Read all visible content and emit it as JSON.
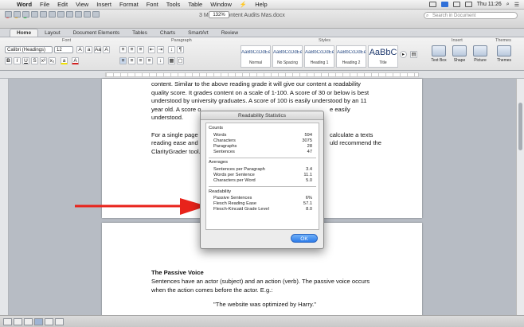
{
  "menubar": {
    "app": "Word",
    "items": [
      "File",
      "Edit",
      "View",
      "Insert",
      "Format",
      "Font",
      "Tools",
      "Table",
      "Window",
      "Help"
    ],
    "clock": "Thu 11:26"
  },
  "window": {
    "title": "3 Metrics Content Audits Mas.docx",
    "zoom": "132%",
    "search_placeholder": "Search in Document"
  },
  "ribbon": {
    "tabs": [
      "Home",
      "Layout",
      "Document Elements",
      "Tables",
      "Charts",
      "SmartArt",
      "Review"
    ],
    "groups": {
      "font": "Font",
      "paragraph": "Paragraph",
      "styles": "Styles",
      "insert": "Insert",
      "themes": "Themes"
    },
    "font_name": "Calibri (Headings)",
    "font_size": "12",
    "styles": [
      {
        "sample": "AaBbCcDdEe",
        "name": "Normal"
      },
      {
        "sample": "AaBbCcDdEe",
        "name": "No Spacing"
      },
      {
        "sample": "AaBbCcDdEe",
        "name": "Heading 1"
      },
      {
        "sample": "AaBbCcDdEe",
        "name": "Heading 2"
      },
      {
        "sample": "AaBbC",
        "name": "Title"
      }
    ],
    "insert_buttons": [
      "Text Box",
      "Shape",
      "Picture",
      "Themes"
    ]
  },
  "document": {
    "page1_lines": [
      "content. Similar to the above reading grade it will give our content a readability",
      "quality score. It grades content on a scale of 1-100. A score of 30 or below is best",
      "understood by university graduates. A score of 100 is easily understood by an 11",
      "year old. A score o",
      "understood.",
      "",
      "For a single page o",
      "reading ease and r",
      "ClarityGrader tool."
    ],
    "page1_right_fragments": [
      "e easily",
      "calculate a texts",
      "uld recommend the"
    ],
    "page2_heading": "The Passive Voice",
    "page2_lines": [
      "Sentences have an actor (subject) and an action (verb). The passive voice occurs",
      "when the action comes before the actor. E.g.:"
    ],
    "page2_quote": "\"The website was optimized by Harry.\""
  },
  "dialog": {
    "title": "Readability Statistics",
    "counts_title": "Counts",
    "counts": [
      {
        "label": "Words",
        "value": "594"
      },
      {
        "label": "Characters",
        "value": "3075"
      },
      {
        "label": "Paragraphs",
        "value": "28"
      },
      {
        "label": "Sentences",
        "value": "47"
      }
    ],
    "averages_title": "Averages",
    "averages": [
      {
        "label": "Sentences per Paragraph",
        "value": "3.4"
      },
      {
        "label": "Words per Sentence",
        "value": "11.1"
      },
      {
        "label": "Characters per Word",
        "value": "5.0"
      }
    ],
    "readability_title": "Readability",
    "readability": [
      {
        "label": "Passive Sentences",
        "value": "6%"
      },
      {
        "label": "Flesch Reading Ease",
        "value": "57.1"
      },
      {
        "label": "Flesch-Kincaid Grade Level",
        "value": "8.0"
      }
    ],
    "ok_label": "OK"
  },
  "colors": {
    "annotation_arrow": "#e8231b",
    "ok_button": "#2d7ce9",
    "accent": "#2f6fd8"
  }
}
